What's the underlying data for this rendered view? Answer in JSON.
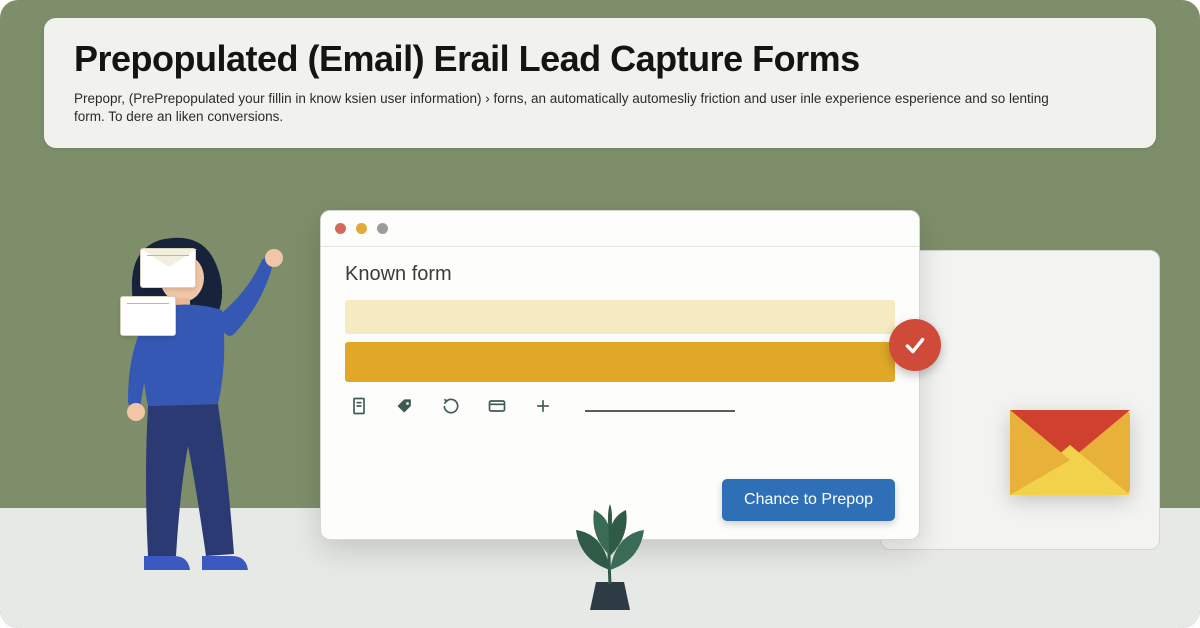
{
  "header": {
    "title": "Prepopulated (Email) Erail Lead Capture Forms",
    "subtitle": "Prepopr, (PrePrepopulated your fillin in know ksien user information) › forns, an automatically automesliy friction and user inle experience esperience and so lenting form.  To dere an liken conversions."
  },
  "browser": {
    "form_title": "Known form",
    "field1_text": "",
    "field2_text": "",
    "cta_label": "Chance to Prepop"
  },
  "icons": {
    "window_close": "close",
    "window_min": "minimize",
    "window_max": "maximize",
    "check": "check",
    "doc": "document",
    "tag": "tag",
    "refresh": "refresh",
    "card": "card",
    "plus": "plus",
    "mail": "mail-envelope"
  },
  "colors": {
    "bg": "#7e8e6a",
    "floor": "#e7e9e6",
    "card": "#f1f1ee",
    "gold": "#e0a826",
    "gold_light": "#f5eac0",
    "red": "#d04a3a",
    "blue": "#2f6fb6",
    "person_shirt": "#3558b5",
    "person_pants": "#2c3a74",
    "hair": "#17233b"
  }
}
